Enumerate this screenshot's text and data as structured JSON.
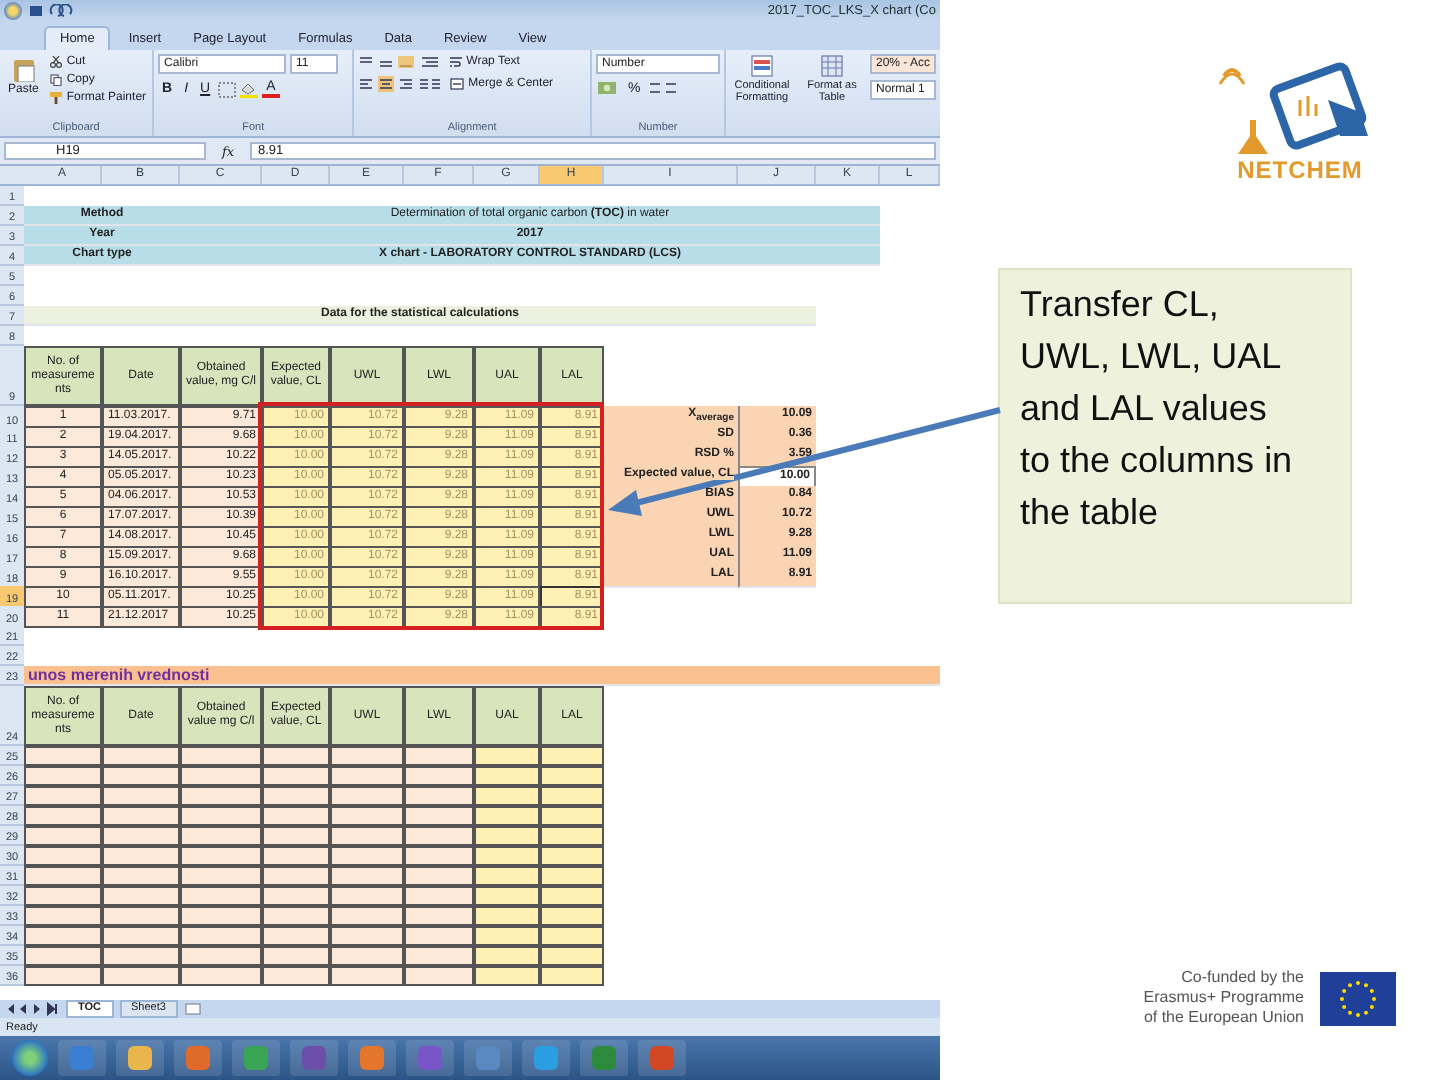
{
  "window": {
    "title": "2017_TOC_LKS_X chart (Co"
  },
  "ribbon_tabs": [
    {
      "label": "Home",
      "selected": true
    },
    {
      "label": "Insert",
      "selected": false
    },
    {
      "label": "Page Layout",
      "selected": false
    },
    {
      "label": "Formulas",
      "selected": false
    },
    {
      "label": "Data",
      "selected": false
    },
    {
      "label": "Review",
      "selected": false
    },
    {
      "label": "View",
      "selected": false
    }
  ],
  "ribbon": {
    "clipboard": {
      "paste": "Paste",
      "cut": "Cut",
      "copy": "Copy",
      "format_painter": "Format Painter",
      "label": "Clipboard"
    },
    "font": {
      "name": "Calibri",
      "size": "11",
      "bold": "B",
      "italic": "I",
      "underline": "U",
      "font_color": "A",
      "label": "Font"
    },
    "alignment": {
      "wrap_text": "Wrap Text",
      "merge": "Merge & Center",
      "label": "Alignment"
    },
    "number": {
      "format": "Number",
      "percent": "%",
      "label": "Number"
    },
    "styles": {
      "conditional": "Conditional Formatting",
      "format_table": "Format as Table",
      "cell_styles": [
        "20% - Acc",
        "Normal 1"
      ]
    }
  },
  "formula_bar": {
    "name_box": "H19",
    "fx": "fx",
    "value": "8.91"
  },
  "column_headers": [
    {
      "label": "A",
      "selected": false
    },
    {
      "label": "B",
      "selected": false
    },
    {
      "label": "C",
      "selected": false
    },
    {
      "label": "D",
      "selected": false
    },
    {
      "label": "E",
      "selected": false
    },
    {
      "label": "F",
      "selected": false
    },
    {
      "label": "G",
      "selected": false
    },
    {
      "label": "H",
      "selected": true
    },
    {
      "label": "I",
      "selected": false
    },
    {
      "label": "J",
      "selected": false
    },
    {
      "label": "K",
      "selected": false
    },
    {
      "label": "L",
      "selected": false
    }
  ],
  "row_headers": [
    {
      "label": "1",
      "selected": false
    },
    {
      "label": "2",
      "selected": false
    },
    {
      "label": "3",
      "selected": false
    },
    {
      "label": "4",
      "selected": false
    },
    {
      "label": "5",
      "selected": false
    },
    {
      "label": "6",
      "selected": false
    },
    {
      "label": "7",
      "selected": false
    },
    {
      "label": "8",
      "selected": false
    },
    {
      "label": "9",
      "selected": false
    },
    {
      "label": "10",
      "selected": false
    },
    {
      "label": "11",
      "selected": false
    },
    {
      "label": "12",
      "selected": false
    },
    {
      "label": "13",
      "selected": false
    },
    {
      "label": "14",
      "selected": false
    },
    {
      "label": "15",
      "selected": false
    },
    {
      "label": "16",
      "selected": false
    },
    {
      "label": "17",
      "selected": false
    },
    {
      "label": "18",
      "selected": false
    },
    {
      "label": "19",
      "selected": true
    },
    {
      "label": "20",
      "selected": false
    },
    {
      "label": "21",
      "selected": false
    },
    {
      "label": "22",
      "selected": false
    },
    {
      "label": "23",
      "selected": false
    },
    {
      "label": "24",
      "selected": false
    },
    {
      "label": "25",
      "selected": false
    },
    {
      "label": "26",
      "selected": false
    },
    {
      "label": "27",
      "selected": false
    },
    {
      "label": "28",
      "selected": false
    },
    {
      "label": "29",
      "selected": false
    },
    {
      "label": "30",
      "selected": false
    },
    {
      "label": "31",
      "selected": false
    },
    {
      "label": "32",
      "selected": false
    },
    {
      "label": "33",
      "selected": false
    },
    {
      "label": "34",
      "selected": false
    },
    {
      "label": "35",
      "selected": false
    },
    {
      "label": "36",
      "selected": false
    }
  ],
  "header": {
    "method_label": "Method",
    "method": "Determination of total organic carbon **(TOC)** in water",
    "year_label": "Year",
    "year": "2017",
    "chart_type_label": "Chart type",
    "chart_type": "X chart - LABORATORY CONTROL STANDARD (LCS)"
  },
  "data_title": "Data for the statistical calculations",
  "data_columns": [
    "No. of measurements",
    "Date",
    "Obtained value, mg C/l",
    "Expected value, CL",
    "UWL",
    "LWL",
    "UAL",
    "LAL"
  ],
  "data_rows": [
    [
      "1",
      "11.03.2017.",
      "9.71",
      "10.00",
      "10.72",
      "9.28",
      "11.09",
      "8.91"
    ],
    [
      "2",
      "19.04.2017.",
      "9.68",
      "10.00",
      "10.72",
      "9.28",
      "11.09",
      "8.91"
    ],
    [
      "3",
      "14.05.2017.",
      "10.22",
      "10.00",
      "10.72",
      "9.28",
      "11.09",
      "8.91"
    ],
    [
      "4",
      "05.05.2017.",
      "10.23",
      "10.00",
      "10.72",
      "9.28",
      "11.09",
      "8.91"
    ],
    [
      "5",
      "04.06.2017.",
      "10.53",
      "10.00",
      "10.72",
      "9.28",
      "11.09",
      "8.91"
    ],
    [
      "6",
      "17.07.2017.",
      "10.39",
      "10.00",
      "10.72",
      "9.28",
      "11.09",
      "8.91"
    ],
    [
      "7",
      "14.08.2017.",
      "10.45",
      "10.00",
      "10.72",
      "9.28",
      "11.09",
      "8.91"
    ],
    [
      "8",
      "15.09.2017.",
      "9.68",
      "10.00",
      "10.72",
      "9.28",
      "11.09",
      "8.91"
    ],
    [
      "9",
      "16.10.2017.",
      "9.55",
      "10.00",
      "10.72",
      "9.28",
      "11.09",
      "8.91"
    ],
    [
      "10",
      "05.11.2017.",
      "10.25",
      "10.00",
      "10.72",
      "9.28",
      "11.09",
      "8.91"
    ],
    [
      "11",
      "21.12.2017",
      "10.25",
      "10.00",
      "10.72",
      "9.28",
      "11.09",
      "8.91"
    ]
  ],
  "statistics": [
    {
      "label": "X$_{average}$",
      "value": "10.09",
      "kind": "computed"
    },
    {
      "label": "SD",
      "value": "0.36",
      "kind": "computed"
    },
    {
      "label": "RSD %",
      "value": "3.59",
      "kind": "computed"
    },
    {
      "label": "Expected value, CL",
      "value": "10.00",
      "kind": "input"
    },
    {
      "label": "BIAS",
      "value": "0.84",
      "kind": "computed"
    },
    {
      "label": "UWL",
      "value": "10.72",
      "kind": "computed"
    },
    {
      "label": "LWL",
      "value": "9.28",
      "kind": "computed"
    },
    {
      "label": "UAL",
      "value": "11.09",
      "kind": "computed"
    },
    {
      "label": "LAL",
      "value": "8.91",
      "kind": "computed"
    }
  ],
  "input_title": "unos merenih vrednosti",
  "input_columns": [
    "No. of measurements",
    "Date",
    "Obtained value mg C/l",
    "Expected value, CL",
    "UWL",
    "LWL",
    "UAL",
    "LAL"
  ],
  "sheet_tabs": [
    {
      "label": "TOC",
      "selected": true
    },
    {
      "label": "Sheet3",
      "selected": false
    }
  ],
  "status": "Ready",
  "logo": "NETCHEM",
  "callout": "Transfer CL, UWL, LWL, UAL and LAL values to the columns in the table",
  "funding": [
    "Co-funded by the",
    "Erasmus+ Programme",
    "of the European Union"
  ]
}
